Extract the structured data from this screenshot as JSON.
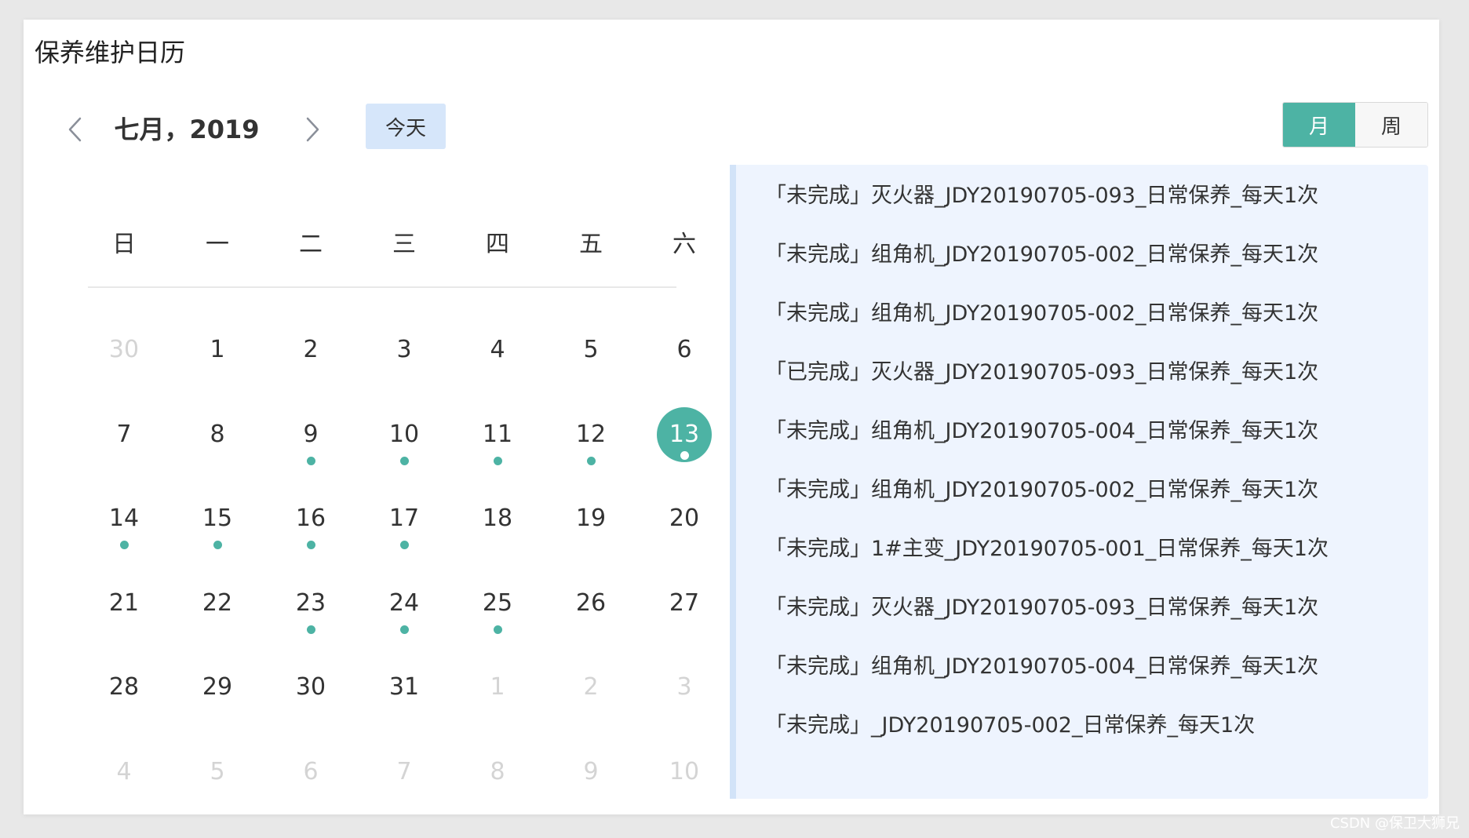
{
  "header": {
    "title": "保养维护日历",
    "month_label": "七月，2019",
    "today_label": "今天",
    "view_month_label": "月",
    "view_week_label": "周",
    "accent_color": "#4db3a4"
  },
  "weekdays": [
    "日",
    "一",
    "二",
    "三",
    "四",
    "五",
    "六"
  ],
  "calendar": {
    "weeks": [
      [
        {
          "day": "30",
          "other": true,
          "dot": false
        },
        {
          "day": "1",
          "other": false,
          "dot": false
        },
        {
          "day": "2",
          "other": false,
          "dot": false
        },
        {
          "day": "3",
          "other": false,
          "dot": false
        },
        {
          "day": "4",
          "other": false,
          "dot": false
        },
        {
          "day": "5",
          "other": false,
          "dot": false
        },
        {
          "day": "6",
          "other": false,
          "dot": false
        }
      ],
      [
        {
          "day": "7",
          "other": false,
          "dot": false
        },
        {
          "day": "8",
          "other": false,
          "dot": false
        },
        {
          "day": "9",
          "other": false,
          "dot": true
        },
        {
          "day": "10",
          "other": false,
          "dot": true
        },
        {
          "day": "11",
          "other": false,
          "dot": true
        },
        {
          "day": "12",
          "other": false,
          "dot": true
        },
        {
          "day": "13",
          "other": false,
          "dot": true,
          "selected": true
        }
      ],
      [
        {
          "day": "14",
          "other": false,
          "dot": true
        },
        {
          "day": "15",
          "other": false,
          "dot": true
        },
        {
          "day": "16",
          "other": false,
          "dot": true
        },
        {
          "day": "17",
          "other": false,
          "dot": true
        },
        {
          "day": "18",
          "other": false,
          "dot": false
        },
        {
          "day": "19",
          "other": false,
          "dot": false
        },
        {
          "day": "20",
          "other": false,
          "dot": false
        }
      ],
      [
        {
          "day": "21",
          "other": false,
          "dot": false
        },
        {
          "day": "22",
          "other": false,
          "dot": false
        },
        {
          "day": "23",
          "other": false,
          "dot": true
        },
        {
          "day": "24",
          "other": false,
          "dot": true
        },
        {
          "day": "25",
          "other": false,
          "dot": true
        },
        {
          "day": "26",
          "other": false,
          "dot": false
        },
        {
          "day": "27",
          "other": false,
          "dot": false
        }
      ],
      [
        {
          "day": "28",
          "other": false,
          "dot": false
        },
        {
          "day": "29",
          "other": false,
          "dot": false
        },
        {
          "day": "30",
          "other": false,
          "dot": false
        },
        {
          "day": "31",
          "other": false,
          "dot": false
        },
        {
          "day": "1",
          "other": true,
          "dot": false
        },
        {
          "day": "2",
          "other": true,
          "dot": false
        },
        {
          "day": "3",
          "other": true,
          "dot": false
        }
      ],
      [
        {
          "day": "4",
          "other": true,
          "dot": false
        },
        {
          "day": "5",
          "other": true,
          "dot": false
        },
        {
          "day": "6",
          "other": true,
          "dot": false
        },
        {
          "day": "7",
          "other": true,
          "dot": false
        },
        {
          "day": "8",
          "other": true,
          "dot": false
        },
        {
          "day": "9",
          "other": true,
          "dot": false
        },
        {
          "day": "10",
          "other": true,
          "dot": false
        }
      ]
    ]
  },
  "events": [
    "「未完成」灭火器_JDY20190705-093_日常保养_每天1次",
    "「未完成」组角机_JDY20190705-002_日常保养_每天1次",
    "「未完成」组角机_JDY20190705-002_日常保养_每天1次",
    "「已完成」灭火器_JDY20190705-093_日常保养_每天1次",
    "「未完成」组角机_JDY20190705-004_日常保养_每天1次",
    "「未完成」组角机_JDY20190705-002_日常保养_每天1次",
    "「未完成」1#主变_JDY20190705-001_日常保养_每天1次",
    "「未完成」灭火器_JDY20190705-093_日常保养_每天1次",
    "「未完成」组角机_JDY20190705-004_日常保养_每天1次",
    "「未完成」_JDY20190705-002_日常保养_每天1次"
  ],
  "watermark": "CSDN @保卫大狮兄"
}
